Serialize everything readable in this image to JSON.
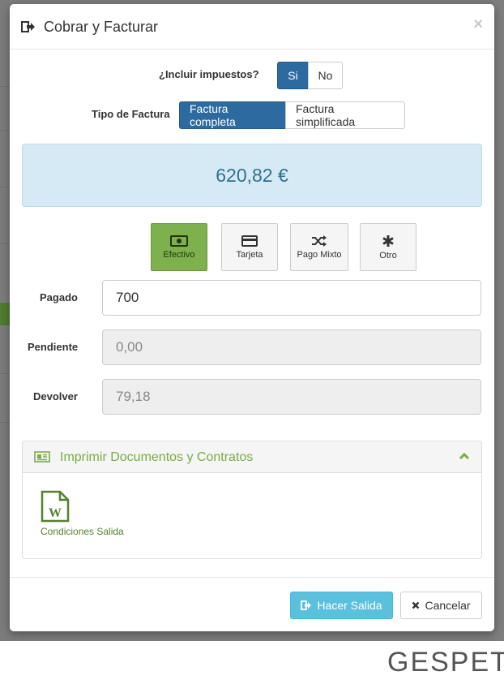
{
  "modal": {
    "title": "Cobrar y Facturar",
    "close_label": "×"
  },
  "taxes": {
    "label": "¿Incluir impuestos?",
    "options": [
      "Si",
      "No"
    ],
    "selected": "Si"
  },
  "invoice_type": {
    "label": "Tipo de Factura",
    "options": [
      "Factura completa",
      "Factura simplificada"
    ],
    "selected": "Factura completa"
  },
  "total": "620,82 €",
  "payment_methods": [
    {
      "label": "Efectivo",
      "icon": "cash-icon",
      "active": true
    },
    {
      "label": "Tarjeta",
      "icon": "credit-card-icon",
      "active": false
    },
    {
      "label": "Pago Mixto",
      "icon": "shuffle-icon",
      "active": false
    },
    {
      "label": "Otro",
      "icon": "asterisk-icon",
      "active": false
    }
  ],
  "fields": {
    "paid": {
      "label": "Pagado",
      "value": "700"
    },
    "pending": {
      "label": "Pendiente",
      "value": "0,00"
    },
    "change": {
      "label": "Devolver",
      "value": "79,18"
    }
  },
  "documents_panel": {
    "title": "Imprimir Documentos y Contratos",
    "documents": [
      {
        "label": "Condiciones Salida",
        "icon": "word-document-icon"
      }
    ]
  },
  "footer": {
    "submit_label": "Hacer Salida",
    "cancel_label": "Cancelar"
  },
  "brand": {
    "logo_text": "GESPET"
  },
  "colors": {
    "primary": "#2d6aa0",
    "success": "#7eb04d",
    "info": "#5bc0de",
    "amount_bg": "#d6eaf5"
  }
}
